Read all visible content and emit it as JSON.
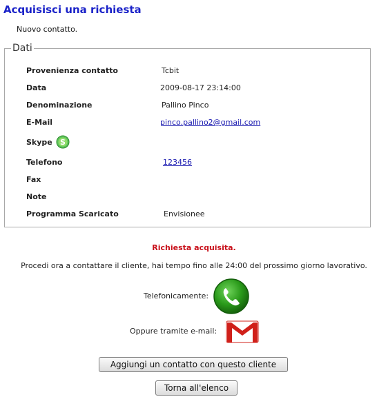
{
  "header": {
    "title": "Acquisisci una richiesta",
    "subtitle": "Nuovo contatto."
  },
  "details": {
    "legend": "Dati",
    "rows": [
      {
        "label": "Provenienza contatto",
        "value": "Tcbit"
      },
      {
        "label": "Data",
        "value": "2009-08-17 23:14:00"
      },
      {
        "label": "Denominazione",
        "value": "Pallino Pinco"
      },
      {
        "label": "E-Mail",
        "value": "pinco.pallino2@gmail.com"
      },
      {
        "label": "Skype",
        "value": ""
      },
      {
        "label": "Telefono",
        "value": "123456"
      },
      {
        "label": "Fax",
        "value": ""
      },
      {
        "label": "Note",
        "value": ""
      },
      {
        "label": "Programma Scaricato",
        "value": "Envisionee"
      }
    ]
  },
  "status": {
    "message": "Richiesta acquisita.",
    "color": "#c8101a"
  },
  "instructions": "Procedi ora a contattare il cliente, hai tempo fino alle 24:00 del prossimo giorno lavorativo.",
  "contact_options": {
    "phone_label": "Telefonicamente:",
    "phone_icon": "phone-icon",
    "email_label": "Oppure tramite e-mail:",
    "email_icon": "gmail-icon"
  },
  "actions": {
    "add_contact_label": "Aggiungi un contatto con questo cliente",
    "back_label": "Torna all'elenco"
  },
  "colors": {
    "title": "#1a22c8",
    "link": "#1a1ab0",
    "phone_green": "#2a9a1a",
    "gmail_red": "#d0201a"
  }
}
